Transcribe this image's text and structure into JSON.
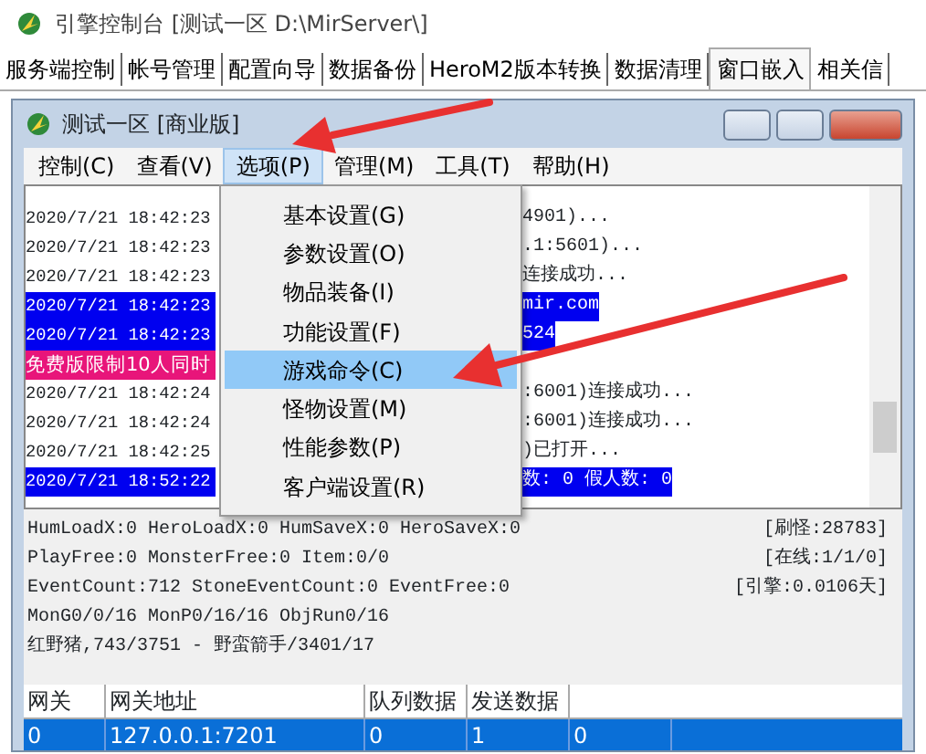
{
  "window": {
    "title": "引擎控制台 [测试一区 D:\\MirServer\\]"
  },
  "tabs": [
    {
      "label": "服务端控制",
      "selected": false
    },
    {
      "label": "帐号管理",
      "selected": false
    },
    {
      "label": "配置向导",
      "selected": false
    },
    {
      "label": "数据备份",
      "selected": false
    },
    {
      "label": "HeroM2版本转换",
      "selected": false
    },
    {
      "label": "数据清理",
      "selected": false
    },
    {
      "label": "窗口嵌入",
      "selected": true
    },
    {
      "label": "相关信",
      "selected": false
    }
  ],
  "inner_window": {
    "title": "测试一区 [商业版]",
    "menu_bar": [
      {
        "label": "控制(C)",
        "selected": false
      },
      {
        "label": "查看(V)",
        "selected": false
      },
      {
        "label": "选项(P)",
        "selected": true
      },
      {
        "label": "管理(M)",
        "selected": false
      },
      {
        "label": "工具(T)",
        "selected": false
      },
      {
        "label": "帮助(H)",
        "selected": false
      }
    ],
    "log": [
      {
        "text": "2020/7/21 18:42:23",
        "tail": "4901)..."
      },
      {
        "text": "2020/7/21 18:42:23",
        "tail": ".1:5601)..."
      },
      {
        "text": "2020/7/21 18:42:23",
        "tail": "连接成功..."
      },
      {
        "text": "2020/7/21 18:42:23",
        "tail": "mir.com",
        "color": "#0000f0"
      },
      {
        "text": "2020/7/21 18:42:23",
        "tail": "524",
        "color": "#0000f0"
      },
      {
        "text": "免费版限制10人同时",
        "color": "#e8157a"
      },
      {
        "text": "2020/7/21 18:42:24",
        "tail": ":6001)连接成功..."
      },
      {
        "text": "2020/7/21 18:42:24",
        "tail": ":6001)连接成功..."
      },
      {
        "text": "2020/7/21 18:42:25",
        "tail": ")已打开..."
      },
      {
        "text": "2020/7/21 18:52:22",
        "tail": "数: 0 假人数: 0",
        "color": "#0000f0"
      }
    ],
    "dropdown": [
      {
        "label": "基本设置(G)",
        "selected": false
      },
      {
        "label": "参数设置(O)",
        "selected": false
      },
      {
        "label": "物品装备(I)",
        "selected": false
      },
      {
        "label": "功能设置(F)",
        "selected": false
      },
      {
        "label": "游戏命令(C)",
        "selected": true
      },
      {
        "label": "怪物设置(M)",
        "selected": false
      },
      {
        "label": "性能参数(P)",
        "selected": false
      },
      {
        "label": "客户端设置(R)",
        "selected": false
      }
    ],
    "status": [
      {
        "text": "HumLoadX:0 HeroLoadX:0 HumSaveX:0 HeroSaveX:0",
        "right": "[刷怪:28783]"
      },
      {
        "text": "PlayFree:0 MonsterFree:0 Item:0/0",
        "right": "[在线:1/1/0]"
      },
      {
        "text": "EventCount:712 StoneEventCount:0 EventFree:0",
        "right": "[引擎:0.0106天]"
      },
      {
        "text": "MonG0/0/16 MonP0/16/16 ObjRun0/16"
      },
      {
        "text": "红野猪,743/3751 - 野蛮箭手/3401/17"
      }
    ],
    "table": {
      "columns": [
        "网关",
        "网关地址",
        "队列数据",
        "发送数据"
      ],
      "rows": [
        {
          "selected": true,
          "cells": [
            "0",
            "127.0.0.1:7201",
            "0",
            "1",
            "0"
          ]
        }
      ]
    }
  }
}
